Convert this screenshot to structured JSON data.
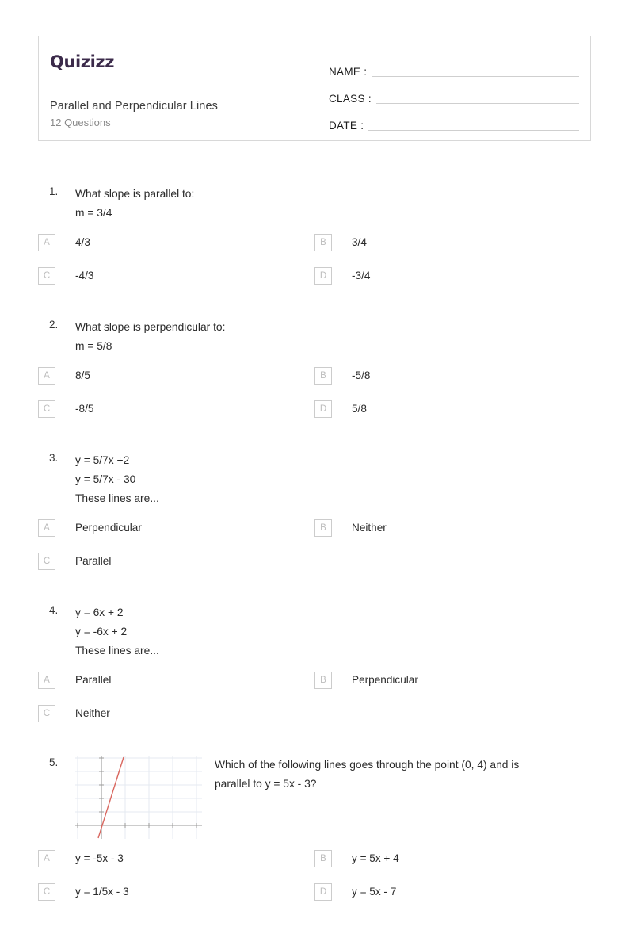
{
  "header": {
    "logo_text": "Quizizz",
    "logo_color": "#3b2a4a",
    "quiz_title": "Parallel and Perpendicular Lines",
    "question_count": "12 Questions",
    "fields": [
      {
        "label": "NAME :"
      },
      {
        "label": "CLASS :"
      },
      {
        "label": "DATE  :"
      }
    ]
  },
  "questions": [
    {
      "number": "1.",
      "lines": [
        "What slope is parallel to:",
        "m = 3/4"
      ],
      "has_image": false,
      "options": [
        {
          "letter": "A",
          "text": "4/3"
        },
        {
          "letter": "B",
          "text": "3/4"
        },
        {
          "letter": "C",
          "text": "-4/3"
        },
        {
          "letter": "D",
          "text": "-3/4"
        }
      ]
    },
    {
      "number": "2.",
      "lines": [
        "What slope is perpendicular to:",
        "m = 5/8"
      ],
      "has_image": false,
      "options": [
        {
          "letter": "A",
          "text": "8/5"
        },
        {
          "letter": "B",
          "text": "-5/8"
        },
        {
          "letter": "C",
          "text": "-8/5"
        },
        {
          "letter": "D",
          "text": "5/8"
        }
      ]
    },
    {
      "number": "3.",
      "lines": [
        "y = 5/7x +2",
        "y = 5/7x - 30",
        "These lines are..."
      ],
      "has_image": false,
      "options": [
        {
          "letter": "A",
          "text": "Perpendicular"
        },
        {
          "letter": "B",
          "text": "Neither"
        },
        {
          "letter": "C",
          "text": "Parallel"
        }
      ]
    },
    {
      "number": "4.",
      "lines": [
        "y = 6x + 2",
        "y = -6x + 2",
        "These lines are..."
      ],
      "has_image": false,
      "options": [
        {
          "letter": "A",
          "text": "Parallel"
        },
        {
          "letter": "B",
          "text": "Perpendicular"
        },
        {
          "letter": "C",
          "text": "Neither"
        }
      ]
    },
    {
      "number": "5.",
      "lines": [
        "Which of the following lines goes through the point (0, 4) and is",
        "parallel to y = 5x - 3?"
      ],
      "has_image": true,
      "image": {
        "name": "coordinate-graph-steep-line",
        "grid_color": "#e4eaf0",
        "axis_color": "#9a9a9a",
        "line_color": "#d9675f"
      },
      "options": [
        {
          "letter": "A",
          "text": "y = -5x - 3"
        },
        {
          "letter": "B",
          "text": "y = 5x + 4"
        },
        {
          "letter": "C",
          "text": "y = 1/5x - 3"
        },
        {
          "letter": "D",
          "text": "y = 5x - 7"
        }
      ]
    }
  ]
}
